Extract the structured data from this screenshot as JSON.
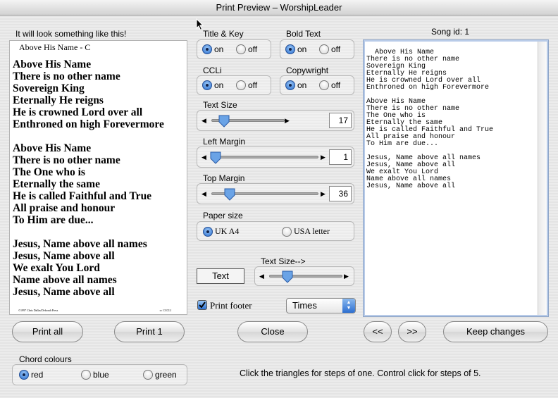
{
  "window": {
    "title": "Print Preview – WorshipLeader"
  },
  "preview": {
    "heading": "It will look something like this!",
    "song_title": "Above His Name - C",
    "lines": "Above His Name\nThere is no other name\nSovereign King\nEternally He reigns\nHe is crowned Lord over all\nEnthroned on high Forevermore\n\nAbove His Name\nThere is no other name\nThe One who is\nEternally the same\nHe is called Faithful and True\nAll praise and honour\nTo Him are due...\n\nJesus, Name above all names\nJesus, Name above all\nWe exalt You Lord\nName above all names\nJesus, Name above all",
    "footer_left": "©1997 Chris Dallas/Deborah Press",
    "footer_right": "cc CCCLI"
  },
  "options": {
    "title_key": {
      "label": "Title & Key",
      "on": "on",
      "off": "off",
      "selected": "on"
    },
    "bold_text": {
      "label": "Bold Text",
      "on": "on",
      "off": "off",
      "selected": "on"
    },
    "ccli": {
      "label": "CCLi",
      "on": "on",
      "off": "off",
      "selected": "on"
    },
    "copyright": {
      "label": "Copywright",
      "on": "on",
      "off": "off",
      "selected": "on"
    },
    "text_size": {
      "label": "Text Size",
      "value": "17"
    },
    "left_margin": {
      "label": "Left Margin",
      "value": "1"
    },
    "top_margin": {
      "label": "Top Margin",
      "value": "36"
    },
    "paper_size": {
      "label": "Paper size",
      "uk": "UK A4",
      "usa": "USA letter",
      "selected": "uk"
    },
    "text_size_label": "Text Size-->",
    "text_button": "Text",
    "print_footer": {
      "label": "Print footer",
      "checked": true
    },
    "font_select": "Times"
  },
  "song": {
    "id_label": "Song id: 1",
    "text": "Above His Name\nThere is no other name\nSovereign King\nEternally He reigns\nHe is crowned Lord over all\nEnthroned on high Forevermore\n\nAbove His Name\nThere is no other name\nThe One who is\nEternally the same\nHe is called Faithful and True\nAll praise and honour\nTo Him are due...\n\nJesus, Name above all names\nJesus, Name above all\nWe exalt You Lord\nName above all names\nJesus, Name above all"
  },
  "buttons": {
    "print_all": "Print all",
    "print_one": "Print 1",
    "close": "Close",
    "prev": "<<",
    "next": ">>",
    "keep": "Keep changes"
  },
  "chord_colours": {
    "label": "Chord colours",
    "red": "red",
    "blue": "blue",
    "green": "green",
    "selected": "red"
  },
  "hint": "Click the triangles for steps of one. Control click for steps of 5."
}
